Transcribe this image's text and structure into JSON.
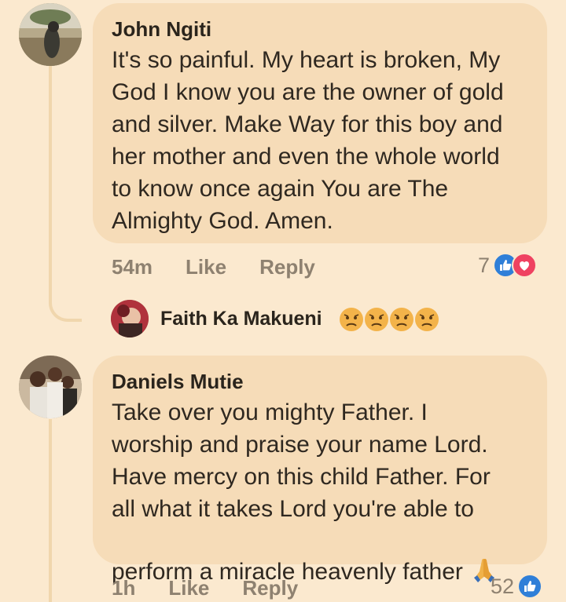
{
  "comments": [
    {
      "author": "John Ngiti",
      "text": "It's so painful. My heart is broken, My\nGod I know you are the owner of gold\nand silver. Make Way for this boy and\nher mother and even the whole world\nto know once again You are The\nAlmighty God. Amen.",
      "time": "54m",
      "like_label": "Like",
      "reply_label": "Reply",
      "reaction_count": "7",
      "reactions": [
        "like-icon",
        "love-icon"
      ],
      "reply_preview": {
        "author": "Faith Ka Makueni",
        "emojis": [
          "sad-face-icon",
          "sad-face-icon",
          "sad-face-icon",
          "sad-face-icon"
        ]
      }
    },
    {
      "author": "Daniels Mutie",
      "text": "Take over you mighty Father. I\nworship and praise your name Lord.\nHave mercy on this child Father. For\nall what it takes Lord you're able to\nperform a miracle heavenly father",
      "trailing_emoji": "praying-hands-icon",
      "time": "1h",
      "like_label": "Like",
      "reply_label": "Reply",
      "reaction_count": "52",
      "reactions": [
        "like-icon"
      ]
    }
  ],
  "colors": {
    "background": "#fbe9cf",
    "bubble": "#f6dcb8",
    "meta_text": "#8e8170",
    "like_blue": "#2f7fd8",
    "love_red": "#ef4261"
  }
}
